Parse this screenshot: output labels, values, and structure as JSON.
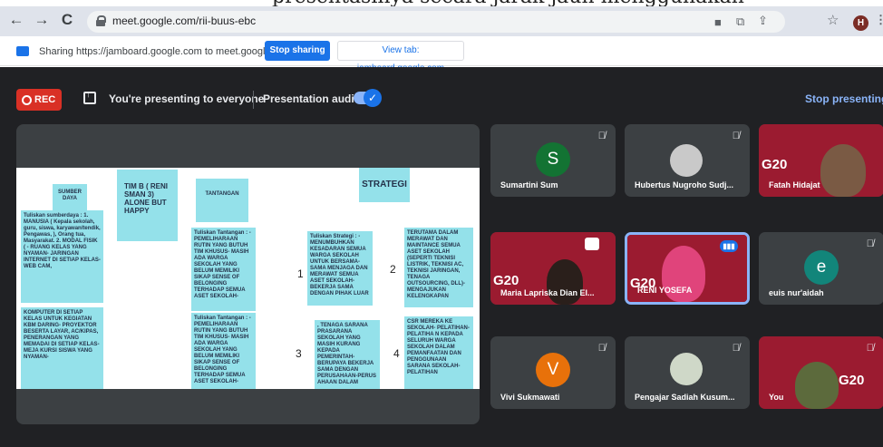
{
  "caption": "presentasinya secara jarak jauh menggunakan",
  "browser": {
    "url": "meet.google.com/rii-buus-ebc",
    "profile_initial": "H",
    "back": "←",
    "forward": "→",
    "reload": "C",
    "icons": [
      "camera-icon",
      "open-tab-icon",
      "share-icon",
      "bookmark-star-icon",
      "menu-icon"
    ]
  },
  "sharebar": {
    "text": "Sharing https://jamboard.google.com to meet.google.com",
    "stop_label": "Stop sharing",
    "view_label": "View tab: jamboard.google.com"
  },
  "meet": {
    "rec_label": "REC",
    "presenting_text": "You're presenting to everyone",
    "audio_label": "Presentation audio",
    "audio_enabled": true,
    "stop_presenting": "Stop presenting"
  },
  "board": {
    "notes": [
      "SUMBER DAYA",
      "TIM B ( RENI SMAN 3) ALONE BUT HAPPY",
      "TANTANGAN",
      "STRATEGI",
      "Tuliskan sumberdaya : 1. MANUSIA ( Kepala sekolah, guru, siswa, karyawan/tendik, Pengawas, ), Orang tua, Masyarakat. 2. MODAL FISIK ( - RUANG KELAS YANG NYAMAN- JARINGAN INTERNET DI SETIAP KELAS- WEB CAM,",
      "KOMPUTER DI SETIAP KELAS UNTUK KEGIATAN KBM DARING- PROYEKTOR BESERTA LAYAR, AC/KIPAS, PENERANGAN YANG MEMADAI DI SETIAP KELAS- MEJA KURSI SISWA YANG NYAMAN-",
      "Tuliskan Tantangan : - PEMELIHARAAN RUTIN YANG BUTUH TIM KHUSUS- MASIH ADA WARGA SEKOLAH YANG BELUM MEMILIKI SIKAP SENSE OF BELONGING TERHADAP SEMUA ASET SEKOLAH-",
      "Tuliskan Tantangan : - PEMELIHARAAN RUTIN YANG BUTUH TIM KHUSUS- MASIH ADA WARGA SEKOLAH YANG BELUM MEMILIKI SIKAP SENSE OF BELONGING TERHADAP SEMUA ASET SEKOLAH-",
      "Tuliskan Strategi : - MENUMBUHKAN KESADARAN SEMUA WARGA SEKOLAH UNTUK BERSAMA-SAMA MENJAGA DAN MERAWAT SEMUA ASET SEKOLAH- BEKERJA SAMA DENGAN PIHAK LUAR",
      "TERUTAMA DALAM MERAWAT DAN MAINTANCE SEMUA ASET SEKOLAH (SEPERTI TEKNISI LISTRIK, TEKNISI AC, TEKNISI JARINGAN, TENAGA OUTSOURCING, DLL)- MENGAJUKAN KELENGKAPAN",
      ", TENAGA SARANA PRASARANA SEKOLAH YANG MASIH KURANG KEPADA PEMERINTAH- BERUPAYA BEKERJA SAMA DENGAN PERUSAHAAN-PERUS AHAAN DALAM",
      "CSR MEREKA KE SEKOLAH- PELATIHAN-PELATIHA N KEPADA SELURUH WARGA SEKOLAH DALAM PEMANFAATAN DAN PENGGUNAAN SARANA SEKOLAH- PELATIHAN"
    ],
    "numbers": [
      "1",
      "2",
      "3",
      "4"
    ]
  },
  "participants": [
    {
      "name": "Sumartini Sum",
      "initial": "S",
      "color": "#137333",
      "muted": true
    },
    {
      "name": "Hubertus Nugroho Sudj...",
      "muted": true
    },
    {
      "name": "Fatah Hidajat",
      "muted": false
    },
    {
      "name": "Maria Lapriska Dian El...",
      "muted": false
    },
    {
      "name": "RENI YOSEFA",
      "muted": false,
      "speaking": true
    },
    {
      "name": "euis nur'aidah",
      "initial": "e",
      "color": "#12857a",
      "muted": true
    },
    {
      "name": "Vivi Sukmawati",
      "initial": "V",
      "color": "#e8710a",
      "muted": true
    },
    {
      "name": "Pengajar Sadiah Kusum...",
      "muted": true
    },
    {
      "name": "You",
      "muted": true
    }
  ],
  "g20_text": "G20",
  "g20_sub": "INDONESIA 2022"
}
